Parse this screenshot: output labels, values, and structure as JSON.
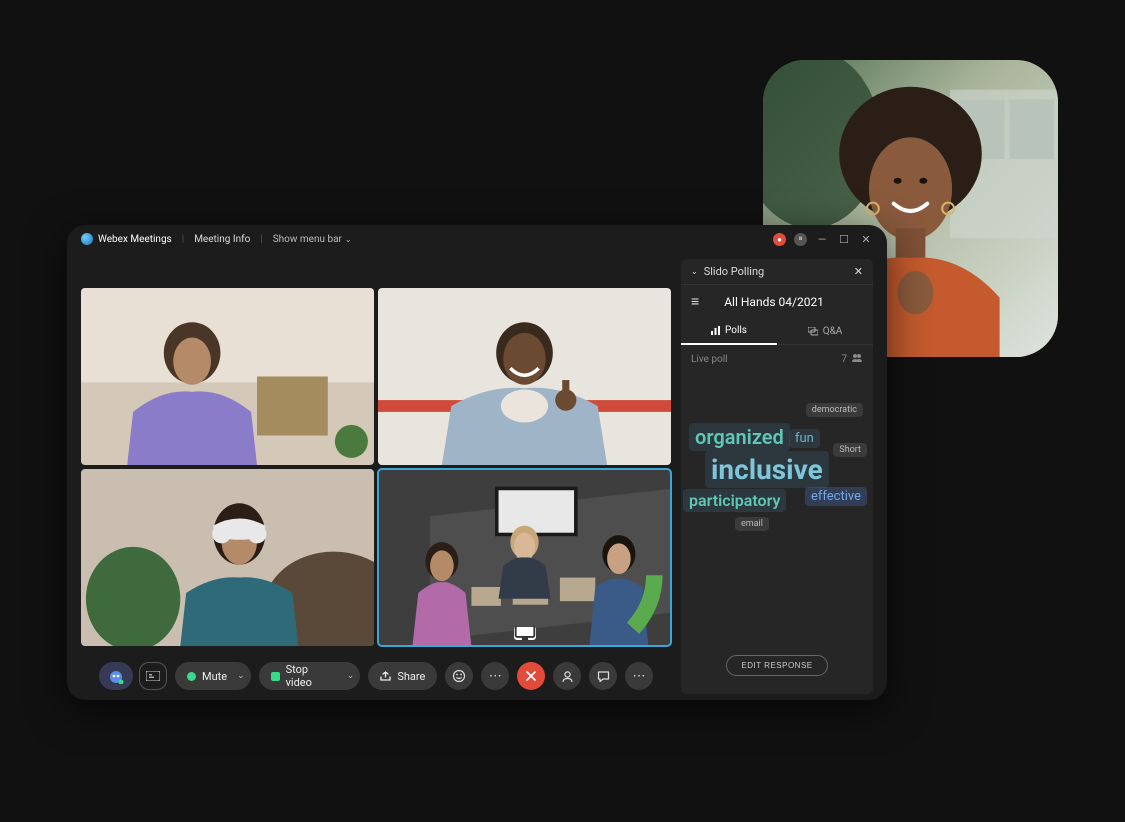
{
  "header": {
    "app_name": "Webex Meetings",
    "meeting_info": "Meeting Info",
    "menu_bar": "Show menu bar"
  },
  "panel": {
    "title": "Slido Polling",
    "event": "All Hands 04/2021",
    "tabs": {
      "polls": "Polls",
      "qa": "Q&A"
    },
    "live_label": "Live poll",
    "participant_count": "7",
    "edit_button": "EDIT RESPONSE",
    "words": {
      "democratic": "democratic",
      "organized": "organized",
      "fun": "fun",
      "short": "Short",
      "inclusive": "inclusive",
      "participatory": "participatory",
      "effective": "effective",
      "email": "email"
    }
  },
  "controls": {
    "mute": "Mute",
    "stop_video": "Stop video",
    "share": "Share"
  }
}
